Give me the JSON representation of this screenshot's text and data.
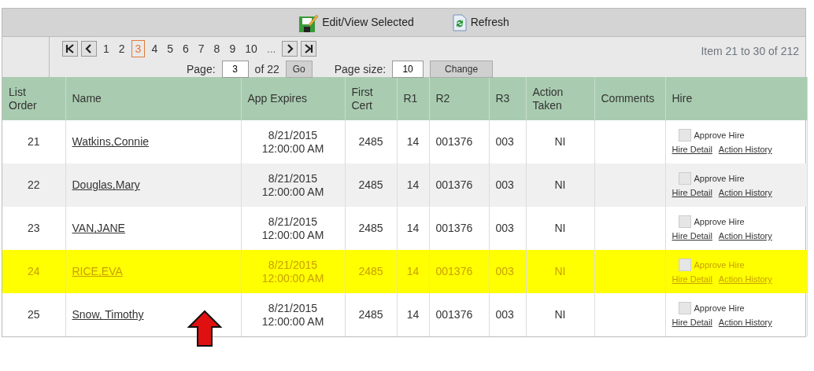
{
  "toolbar": {
    "buttons": [
      {
        "kind": "edit",
        "label": "Edit/View Selected"
      },
      {
        "kind": "refresh",
        "label": "Refresh"
      }
    ]
  },
  "pager": {
    "nav": [
      {
        "kind": "first"
      },
      {
        "kind": "prev"
      }
    ],
    "pages": [
      {
        "label": "1",
        "selected": false
      },
      {
        "label": "2",
        "selected": false
      },
      {
        "label": "3",
        "selected": true
      },
      {
        "label": "4",
        "selected": false
      },
      {
        "label": "5",
        "selected": false
      },
      {
        "label": "6",
        "selected": false
      },
      {
        "label": "7",
        "selected": false
      },
      {
        "label": "8",
        "selected": false
      },
      {
        "label": "9",
        "selected": false
      },
      {
        "label": "10",
        "selected": false
      }
    ],
    "ellipsis": "...",
    "nav_end": [
      {
        "kind": "next"
      },
      {
        "kind": "last"
      }
    ],
    "page_label": "Page:",
    "page_value": "3",
    "of_label": "of 22",
    "go": "Go",
    "size_label": "Page size:",
    "size_value": "10",
    "change": "Change",
    "summary": "Item 21 to 30 of 212"
  },
  "table": {
    "columns": [
      "List Order",
      "Name",
      "App Expires",
      "First Cert",
      "R1",
      "R2",
      "R3",
      "Action Taken",
      "Comments",
      "Hire"
    ],
    "rows": [
      {
        "order": "21",
        "name": "Watkins,Connie",
        "expires": "8/21/2015 12:00:00 AM",
        "first_cert": "2485",
        "r1": "14",
        "r2": "001376",
        "r3": "003",
        "action": "NI",
        "highlighted": false,
        "approve": {
          "label": "Approve Hire",
          "checked": false
        },
        "links": [
          "Hire Detail",
          "Action History"
        ]
      },
      {
        "order": "22",
        "name": "Douglas,Mary",
        "expires": "8/21/2015 12:00:00 AM",
        "first_cert": "2485",
        "r1": "14",
        "r2": "001376",
        "r3": "003",
        "action": "NI",
        "highlighted": false,
        "approve": {
          "label": "Approve Hire",
          "checked": false
        },
        "links": [
          "Hire Detail",
          "Action History"
        ]
      },
      {
        "order": "23",
        "name": "VAN,JANE",
        "expires": "8/21/2015 12:00:00 AM",
        "first_cert": "2485",
        "r1": "14",
        "r2": "001376",
        "r3": "003",
        "action": "NI",
        "highlighted": false,
        "approve": {
          "label": "Approve Hire",
          "checked": false
        },
        "links": [
          "Hire Detail",
          "Action History"
        ]
      },
      {
        "order": "24",
        "name": "RICE,EVA",
        "expires": "8/21/2015 12:00:00 AM",
        "first_cert": "2485",
        "r1": "14",
        "r2": "001376",
        "r3": "003",
        "action": "NI",
        "highlighted": true,
        "approve": {
          "label": "Approve Hire",
          "checked": false
        },
        "links": [
          "Hire Detail",
          "Action History"
        ]
      },
      {
        "order": "25",
        "name": "Snow, Timothy",
        "expires": "8/21/2015 12:00:00 AM",
        "first_cert": "2485",
        "r1": "14",
        "r2": "001376",
        "r3": "003",
        "action": "NI",
        "highlighted": false,
        "approve": {
          "label": "Approve Hire",
          "checked": false
        },
        "links": [
          "Hire Detail",
          "Action History"
        ]
      }
    ]
  }
}
